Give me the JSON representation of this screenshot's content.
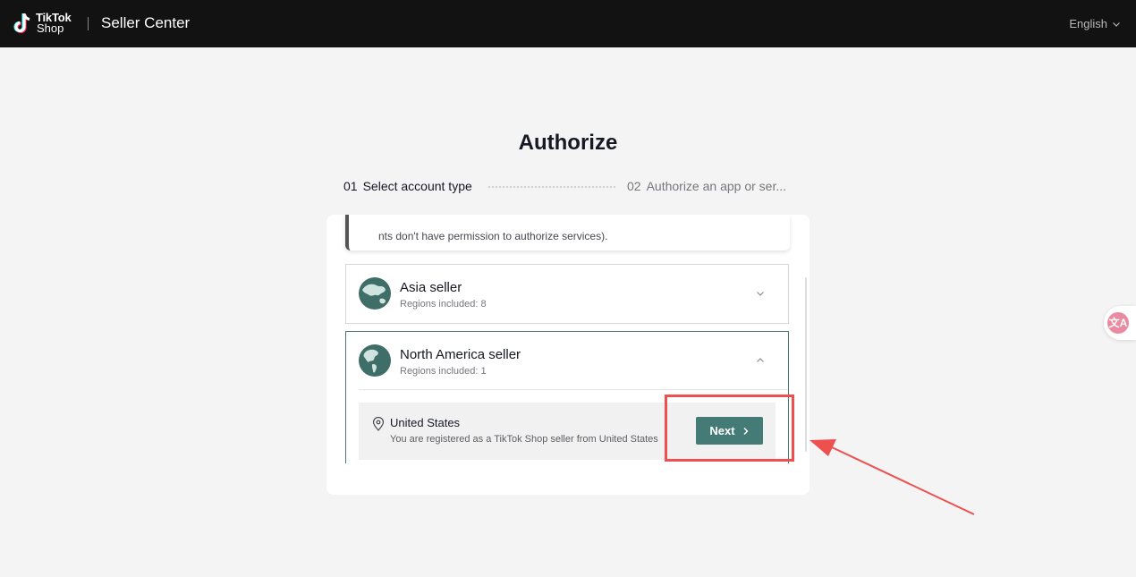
{
  "header": {
    "logo_line1": "TikTok",
    "logo_line2": "Shop",
    "app_title": "Seller Center",
    "language": "English"
  },
  "page": {
    "title": "Authorize"
  },
  "steps": [
    {
      "number": "01",
      "label": "Select account type",
      "active": true
    },
    {
      "number": "02",
      "label": "Authorize an app or ser...",
      "active": false
    }
  ],
  "tip_text": "nts don't have permission to authorize services).",
  "sellers": [
    {
      "title": "Asia seller",
      "regions": "Regions included: 8",
      "expanded": false,
      "icon": "globe-asia-icon"
    },
    {
      "title": "North America seller",
      "regions": "Regions included: 1",
      "expanded": true,
      "icon": "globe-americas-icon"
    }
  ],
  "region_option": {
    "name": "United States",
    "description": "You are registered as a TikTok Shop seller from United States",
    "button_label": "Next"
  },
  "colors": {
    "topbar": "#121212",
    "accent": "#457b77",
    "highlight": "#ee4f4f",
    "background": "#f4f4f4"
  }
}
